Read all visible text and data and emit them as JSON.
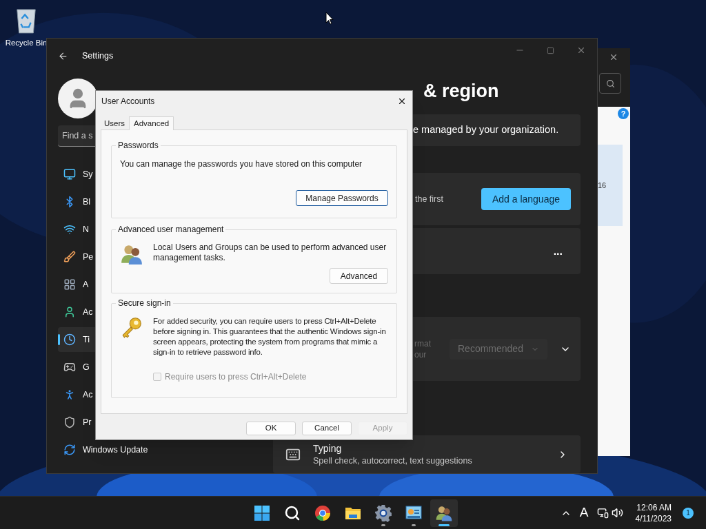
{
  "desktop": {
    "icons": [
      {
        "label": "Recycle Bin"
      }
    ]
  },
  "background_window": {
    "badge": "?",
    "text": "16"
  },
  "settings": {
    "title": "Settings",
    "search": {
      "placeholder": "Find a s"
    },
    "nav_items": [
      {
        "kind": "system",
        "label": "Sy",
        "selected": false
      },
      {
        "kind": "bluetooth",
        "label": "Bl",
        "selected": false
      },
      {
        "kind": "network",
        "label": "N",
        "selected": false
      },
      {
        "kind": "personalization",
        "label": "Pe",
        "selected": false
      },
      {
        "kind": "apps",
        "label": "A",
        "selected": false
      },
      {
        "kind": "accounts",
        "label": "Ac",
        "selected": false
      },
      {
        "kind": "time",
        "label": "Ti",
        "selected": true
      },
      {
        "kind": "gaming",
        "label": "G",
        "selected": false
      },
      {
        "kind": "accessibility",
        "label": "Ac",
        "selected": false
      },
      {
        "kind": "privacy",
        "label": "Pr",
        "selected": false
      },
      {
        "kind": "update",
        "label": "Windows Update",
        "selected": false
      }
    ],
    "heading": "& region",
    "cards": [
      {
        "kind": "notice",
        "text": "e managed by your organization."
      },
      {
        "kind": "action",
        "text": "the first",
        "button": "Add a language"
      },
      {
        "kind": "more",
        "button": "..."
      },
      {
        "kind": "dropdown",
        "lines": [
          "rmat",
          "our"
        ],
        "value": "Recommended",
        "disabled": true
      },
      {
        "kind": "link",
        "title": "Typing",
        "subtitle": "Spell check, autocorrect, text suggestions"
      }
    ]
  },
  "dialog": {
    "title": "User Accounts",
    "tabs": [
      {
        "label": "Users",
        "selected": false
      },
      {
        "label": "Advanced",
        "selected": true
      }
    ],
    "groups": [
      {
        "kind": "passwords",
        "title": "Passwords",
        "text": "You can manage the passwords you have stored on this computer",
        "button": "Manage Passwords"
      },
      {
        "kind": "management",
        "title": "Advanced user management",
        "text": "Local Users and Groups can be used to perform advanced user management tasks.",
        "button": "Advanced"
      },
      {
        "kind": "signin",
        "title": "Secure sign-in",
        "text": "For added security, you can require users to press Ctrl+Alt+Delete before signing in. This guarantees that the authentic Windows sign-in screen appears, protecting the system from programs that mimic a sign-in to retrieve password info.",
        "checkbox": {
          "label": "Require users to press Ctrl+Alt+Delete",
          "checked": false,
          "disabled": true
        }
      }
    ],
    "buttons": [
      {
        "label": "OK",
        "disabled": false
      },
      {
        "label": "Cancel",
        "disabled": false
      },
      {
        "label": "Apply",
        "disabled": true
      }
    ]
  },
  "taskbar": {
    "apps": [
      {
        "kind": "start",
        "running": false,
        "active": false
      },
      {
        "kind": "search",
        "running": false,
        "active": false
      },
      {
        "kind": "browser",
        "running": false,
        "active": false
      },
      {
        "kind": "folder",
        "running": false,
        "active": false
      },
      {
        "kind": "settings",
        "running": true,
        "active": false
      },
      {
        "kind": "control",
        "running": true,
        "active": false
      },
      {
        "kind": "users",
        "running": true,
        "active": true
      }
    ],
    "input_indicator": "A",
    "time": "12:06 AM",
    "date": "4/11/2023",
    "notifications": "1"
  }
}
